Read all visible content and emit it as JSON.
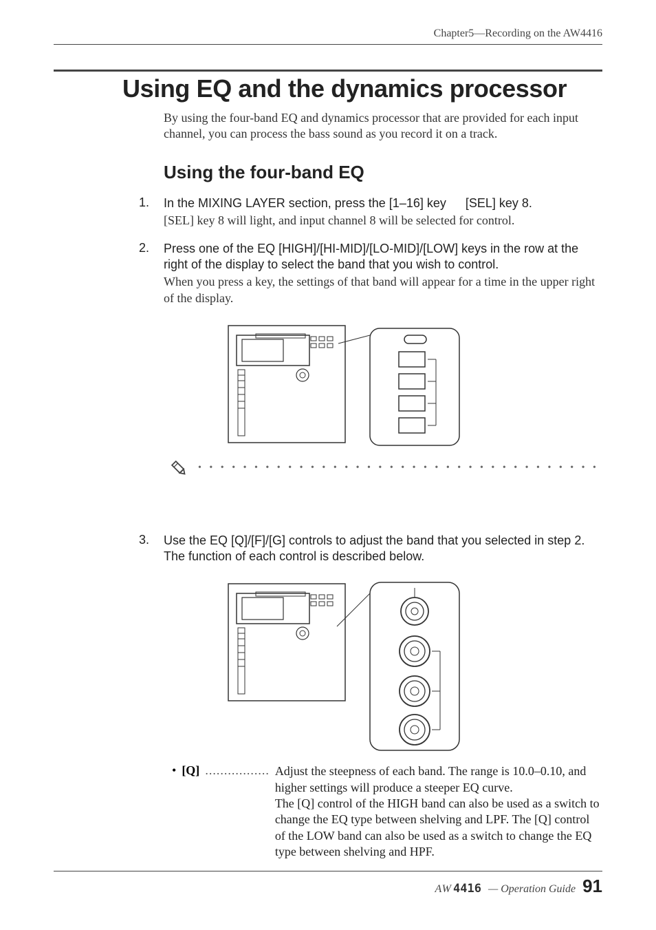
{
  "chapter_header": "Chapter5—Recording on the AW4416",
  "section_title": "Using EQ and the dynamics processor",
  "intro": "By using the four-band EQ and dynamics processor that are provided for each input channel, you can process the bass sound as you record it on a track.",
  "subsection_title": "Using the four-band EQ",
  "steps": [
    {
      "num": "1.",
      "instr": "In the MIXING LAYER section, press the [1–16] key   [SEL] key 8.",
      "detail": "[SEL] key 8 will light, and input channel 8 will be selected for control."
    },
    {
      "num": "2.",
      "instr": "Press one of the EQ [HIGH]/[HI-MID]/[LO-MID]/[LOW] keys in the row at the right of the display to select the band that you wish to control.",
      "detail": "When you press a key, the settings of that band will appear for a time in the upper right of the display."
    },
    {
      "num": "3.",
      "instr": "Use the EQ [Q]/[F]/[G] controls to adjust the band that you selected in step 2. The function of each control is described below.",
      "detail": ""
    }
  ],
  "definition": {
    "label": "[Q]",
    "leader": ".................",
    "text": "Adjust the steepness of each band. The range is 10.0–0.10, and higher settings will produce a steeper EQ curve.\nThe [Q] control of the HIGH band can also be used as a switch to change the EQ type between shelving and LPF. The [Q] control of the LOW band can also be used as a switch to change the EQ type between shelving and HPF."
  },
  "note_dots": "• • • • • • • • • • • • • • • • • • • • • • • • • • • • • • • • • • • • • • • • • • • • •",
  "footer": {
    "logo_aw": "AW",
    "logo_num": "4416",
    "text": "— Operation Guide",
    "page": "91"
  }
}
